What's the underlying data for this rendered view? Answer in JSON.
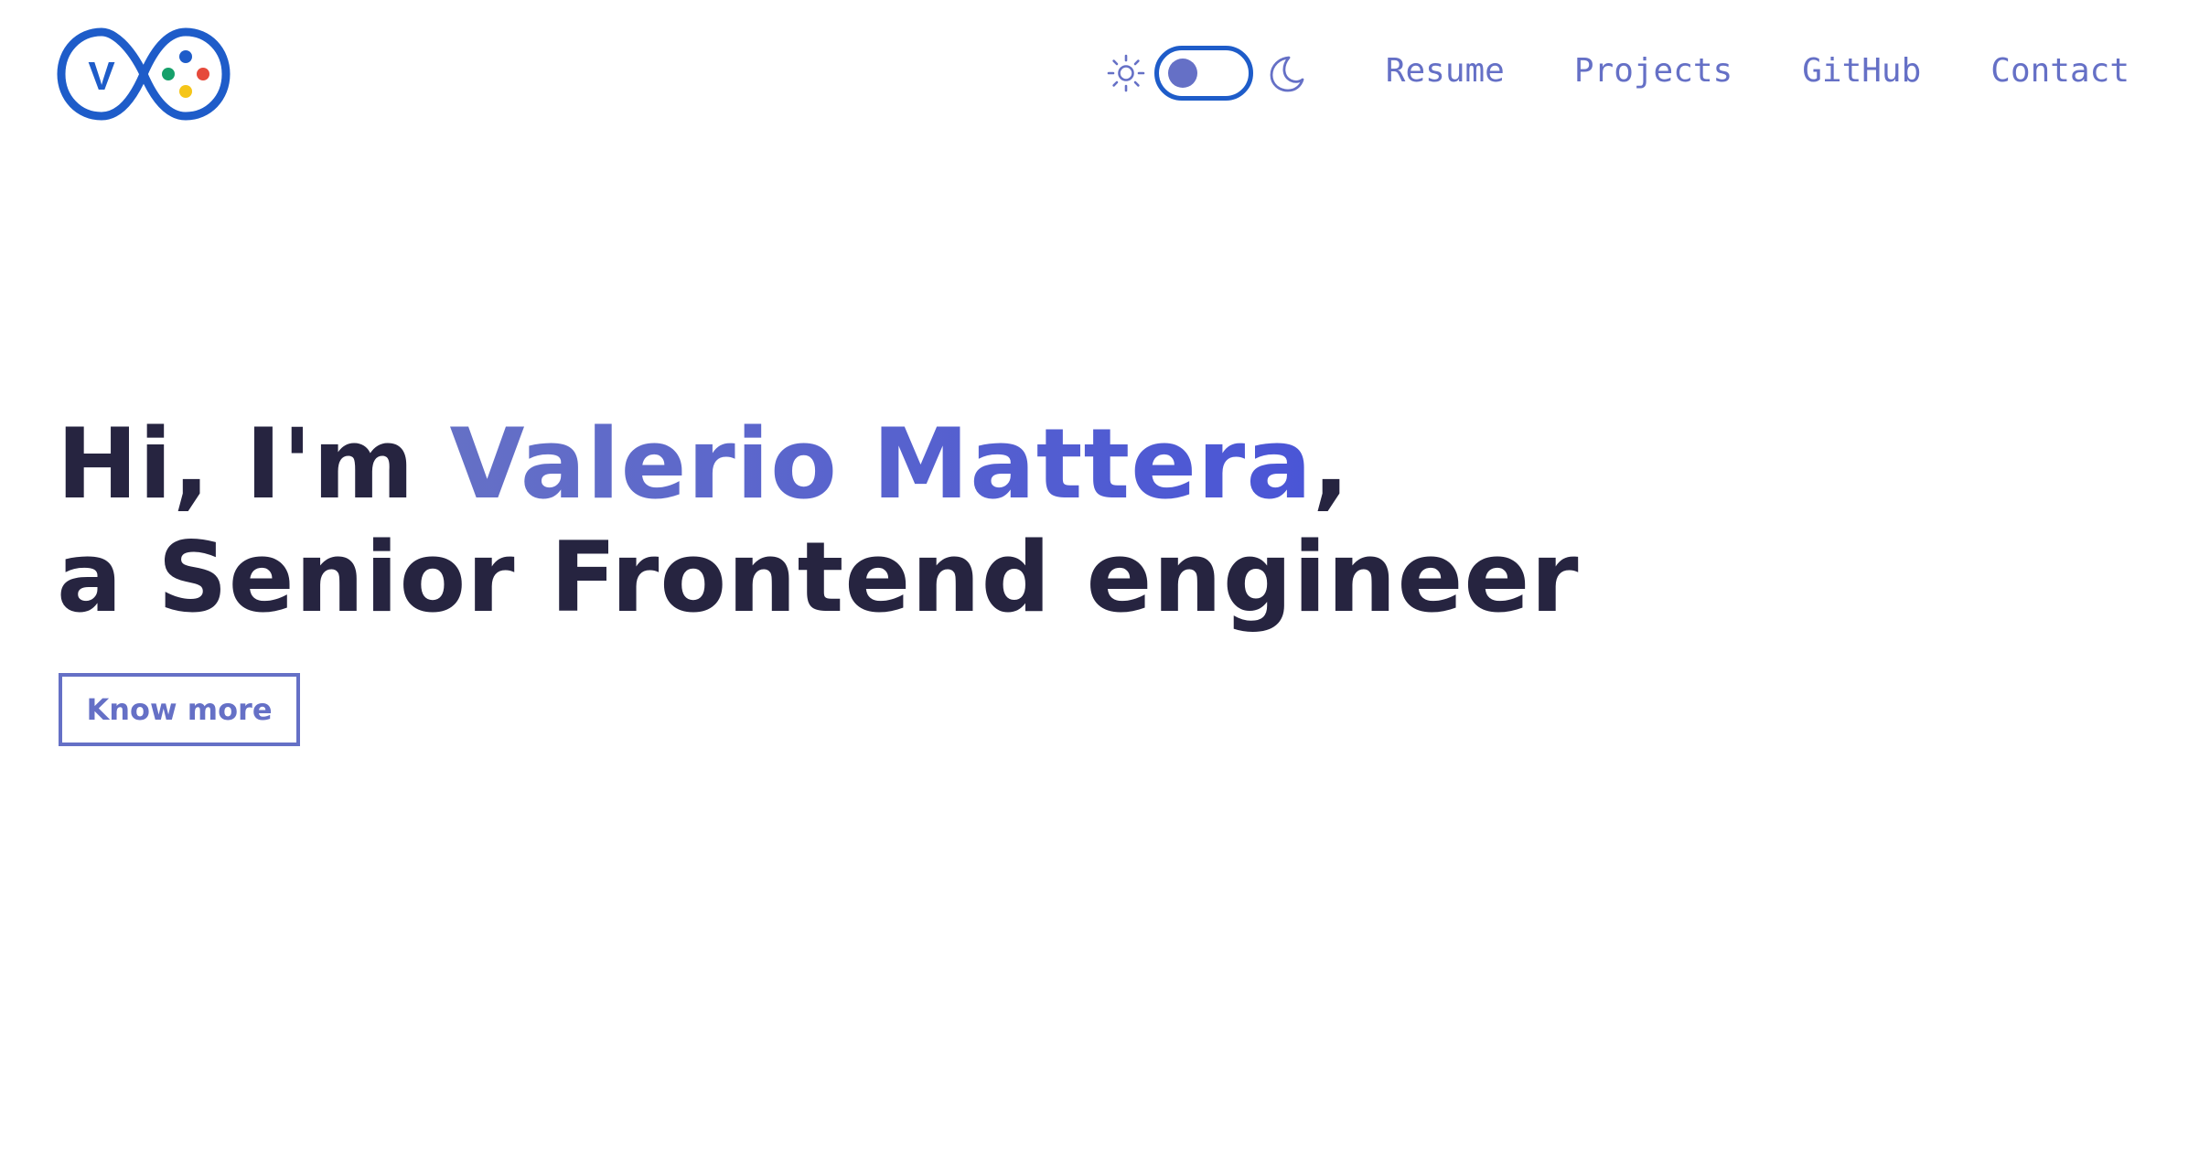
{
  "colors": {
    "logo_blue": "#1e5cc9",
    "nav_text": "#6570c6",
    "heading_dark": "#262440",
    "name_gradient_start": "#6570c6",
    "name_gradient_end": "#4a55d6",
    "toggle_knob": "#6570c6",
    "dot_blue": "#1e5cc9",
    "dot_green": "#16a06a",
    "dot_red": "#e64a3b",
    "dot_yellow": "#f5c518"
  },
  "header": {
    "logo": {
      "letter": "V",
      "icon": "infinity-gamepad-logo"
    },
    "theme_toggle": {
      "left_icon": "sun-icon",
      "right_icon": "moon-icon",
      "state": "light"
    },
    "nav": [
      {
        "label": "Resume"
      },
      {
        "label": "Projects"
      },
      {
        "label": "GitHub"
      },
      {
        "label": "Contact"
      }
    ]
  },
  "hero": {
    "greeting": "Hi, I'm ",
    "name": "Valerio Mattera",
    "comma": ",",
    "role_line": "a Senior Frontend engineer",
    "cta_label": "Know more"
  }
}
